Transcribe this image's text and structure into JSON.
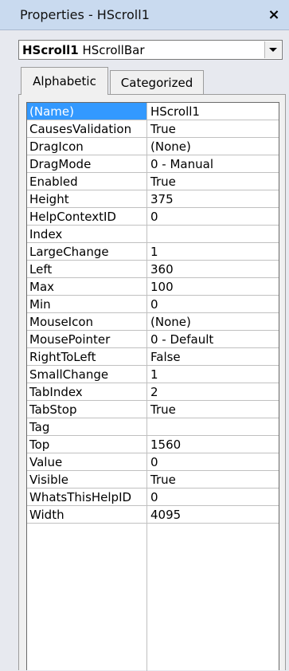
{
  "window": {
    "title": "Properties - HScroll1",
    "close_glyph": "×"
  },
  "object_selector": {
    "object_name": "HScroll1",
    "object_type": "HScrollBar"
  },
  "tabs": [
    {
      "label": "Alphabetic",
      "active": true
    },
    {
      "label": "Categorized",
      "active": false
    }
  ],
  "selection_color": "#3399ff",
  "properties": [
    {
      "name": "(Name)",
      "value": "HScroll1"
    },
    {
      "name": "CausesValidation",
      "value": "True"
    },
    {
      "name": "DragIcon",
      "value": "(None)"
    },
    {
      "name": "DragMode",
      "value": "0 - Manual"
    },
    {
      "name": "Enabled",
      "value": "True"
    },
    {
      "name": "Height",
      "value": "375"
    },
    {
      "name": "HelpContextID",
      "value": "0"
    },
    {
      "name": "Index",
      "value": ""
    },
    {
      "name": "LargeChange",
      "value": "1"
    },
    {
      "name": "Left",
      "value": "360"
    },
    {
      "name": "Max",
      "value": "100"
    },
    {
      "name": "Min",
      "value": "0"
    },
    {
      "name": "MouseIcon",
      "value": "(None)"
    },
    {
      "name": "MousePointer",
      "value": "0 - Default"
    },
    {
      "name": "RightToLeft",
      "value": "False"
    },
    {
      "name": "SmallChange",
      "value": "1"
    },
    {
      "name": "TabIndex",
      "value": "2"
    },
    {
      "name": "TabStop",
      "value": "True"
    },
    {
      "name": "Tag",
      "value": ""
    },
    {
      "name": "Top",
      "value": "1560"
    },
    {
      "name": "Value",
      "value": "0"
    },
    {
      "name": "Visible",
      "value": "True"
    },
    {
      "name": "WhatsThisHelpID",
      "value": "0"
    },
    {
      "name": "Width",
      "value": "4095"
    }
  ]
}
